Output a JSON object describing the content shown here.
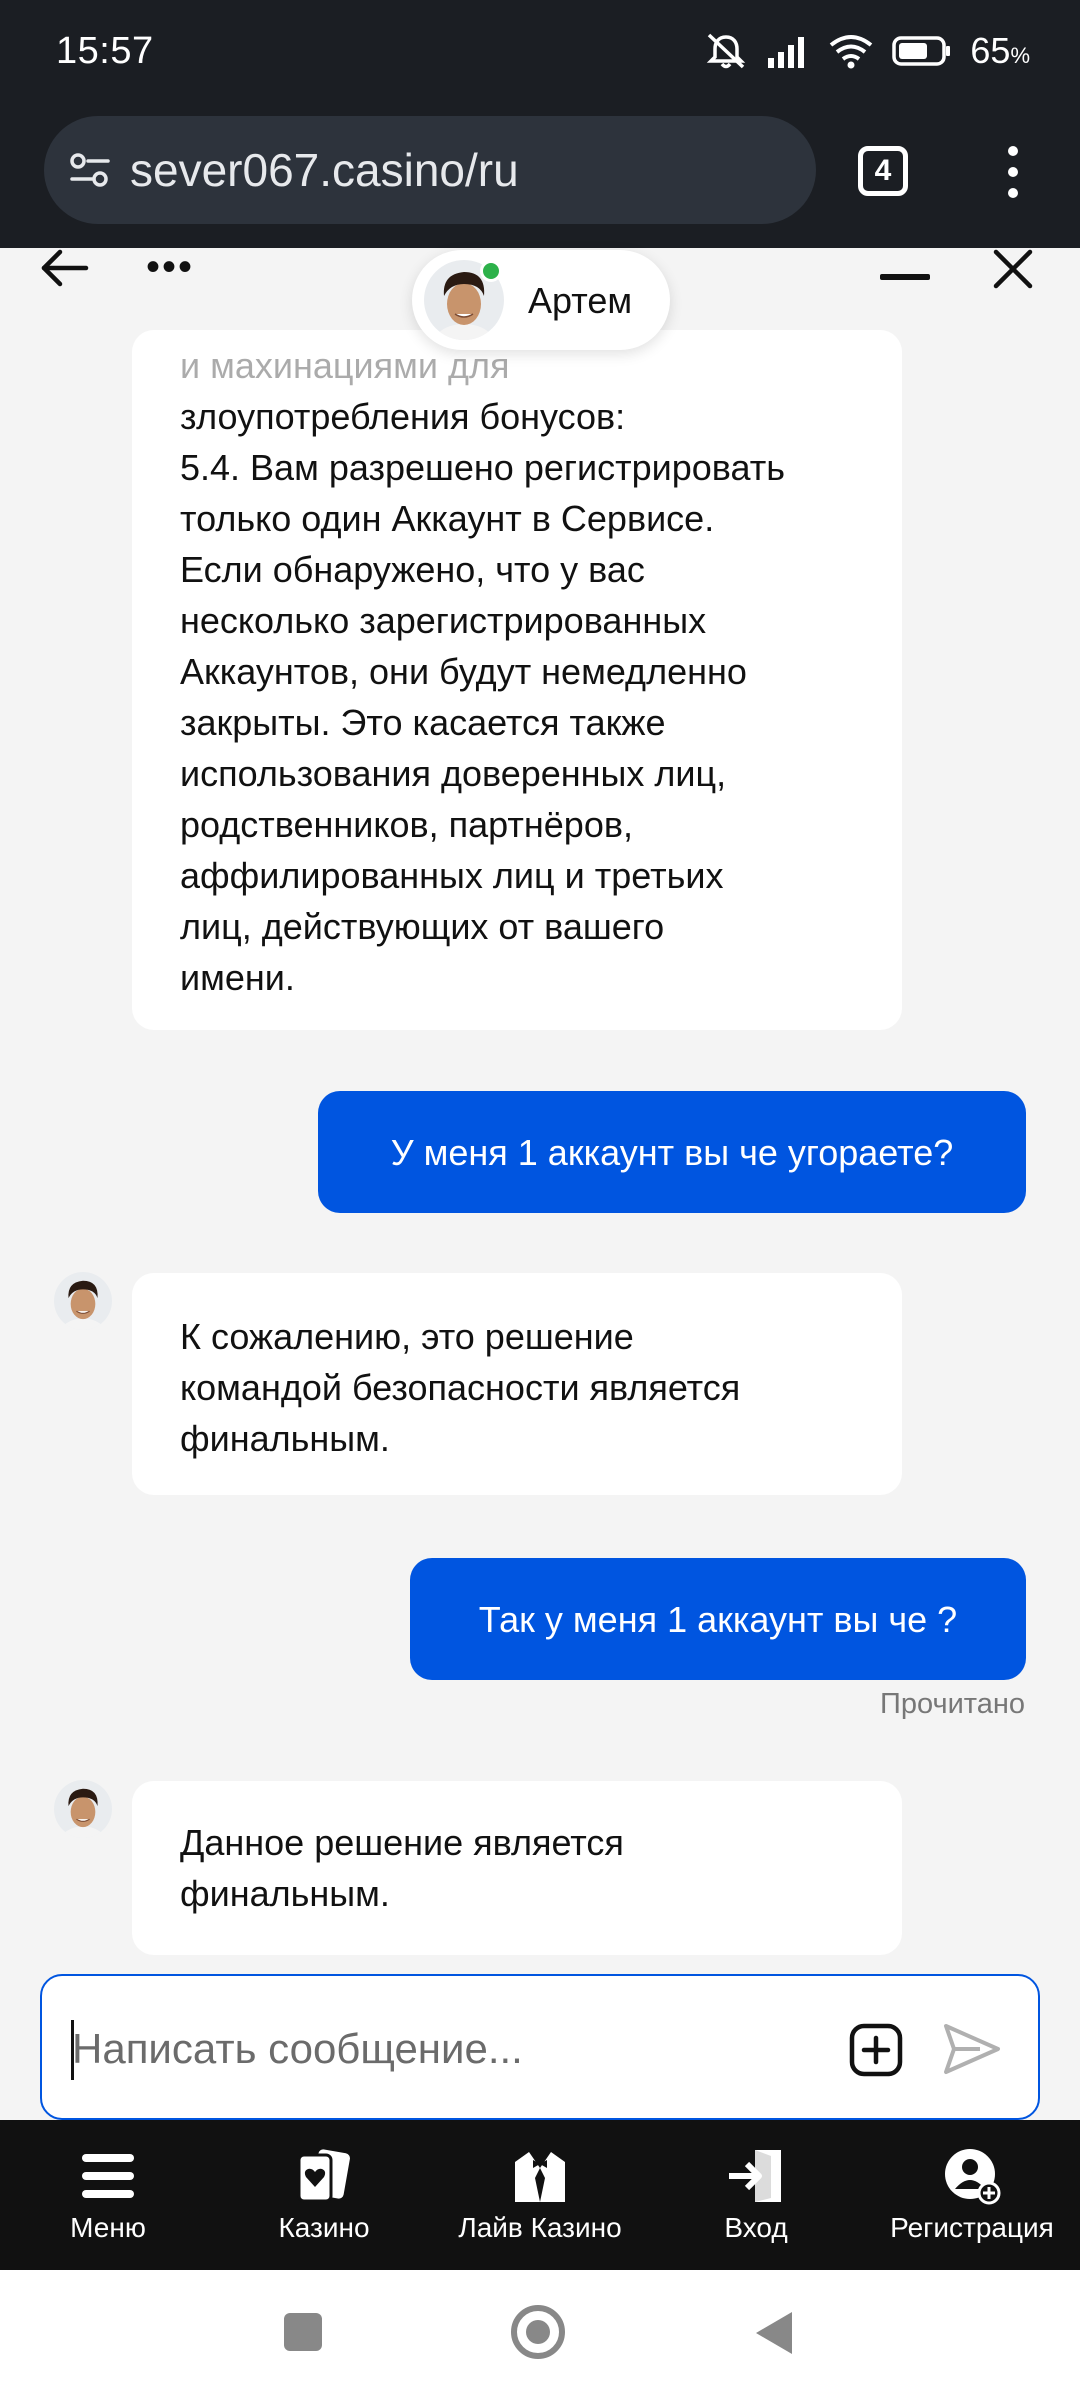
{
  "status_bar": {
    "time": "15:57",
    "battery_value": "65",
    "battery_unit": "%"
  },
  "browser": {
    "url": "sever067.casino/ru",
    "tab_count": "4"
  },
  "chat": {
    "agent_name": "Артем",
    "messages": [
      {
        "from": "agent",
        "lines": [
          "и махинациями для",
          "злоупотребления бонусов:",
          "5.4. Вам разрешено регистрировать",
          "только один Аккаунт в Сервисе.",
          "Если обнаружено, что у вас",
          "несколько зарегистрированных",
          "Аккаунтов, они будут немедленно",
          "закрыты. Это касается также",
          "использования доверенных лиц,",
          "родственников, партнёров,",
          "аффилированных лиц и третьих",
          "лиц, действующих от вашего",
          "имени."
        ]
      },
      {
        "from": "user",
        "text": "У меня 1 аккаунт вы че угораете?"
      },
      {
        "from": "agent",
        "lines": [
          "К сожалению, это решение",
          "командой безопасности является",
          "финальным."
        ]
      },
      {
        "from": "user",
        "text": "Так у меня 1 аккаунт вы че ?"
      },
      {
        "from": "agent",
        "lines": [
          "Данное решение является",
          "финальным."
        ]
      }
    ],
    "read_status": "Прочитано",
    "composer_placeholder": "Написать сообщение..."
  },
  "bottom_nav": {
    "items": [
      {
        "label": "Меню",
        "icon": "menu-icon"
      },
      {
        "label": "Казино",
        "icon": "cards-icon"
      },
      {
        "label": "Лайв Казино",
        "icon": "tuxedo-icon"
      },
      {
        "label": "Вход",
        "icon": "login-icon"
      },
      {
        "label": "Регистрация",
        "icon": "user-add-icon"
      }
    ]
  },
  "colors": {
    "accent": "#0055e0",
    "dark_bg": "#1b1e23",
    "chat_bg": "#f4f4f4",
    "online": "#2db14a"
  }
}
